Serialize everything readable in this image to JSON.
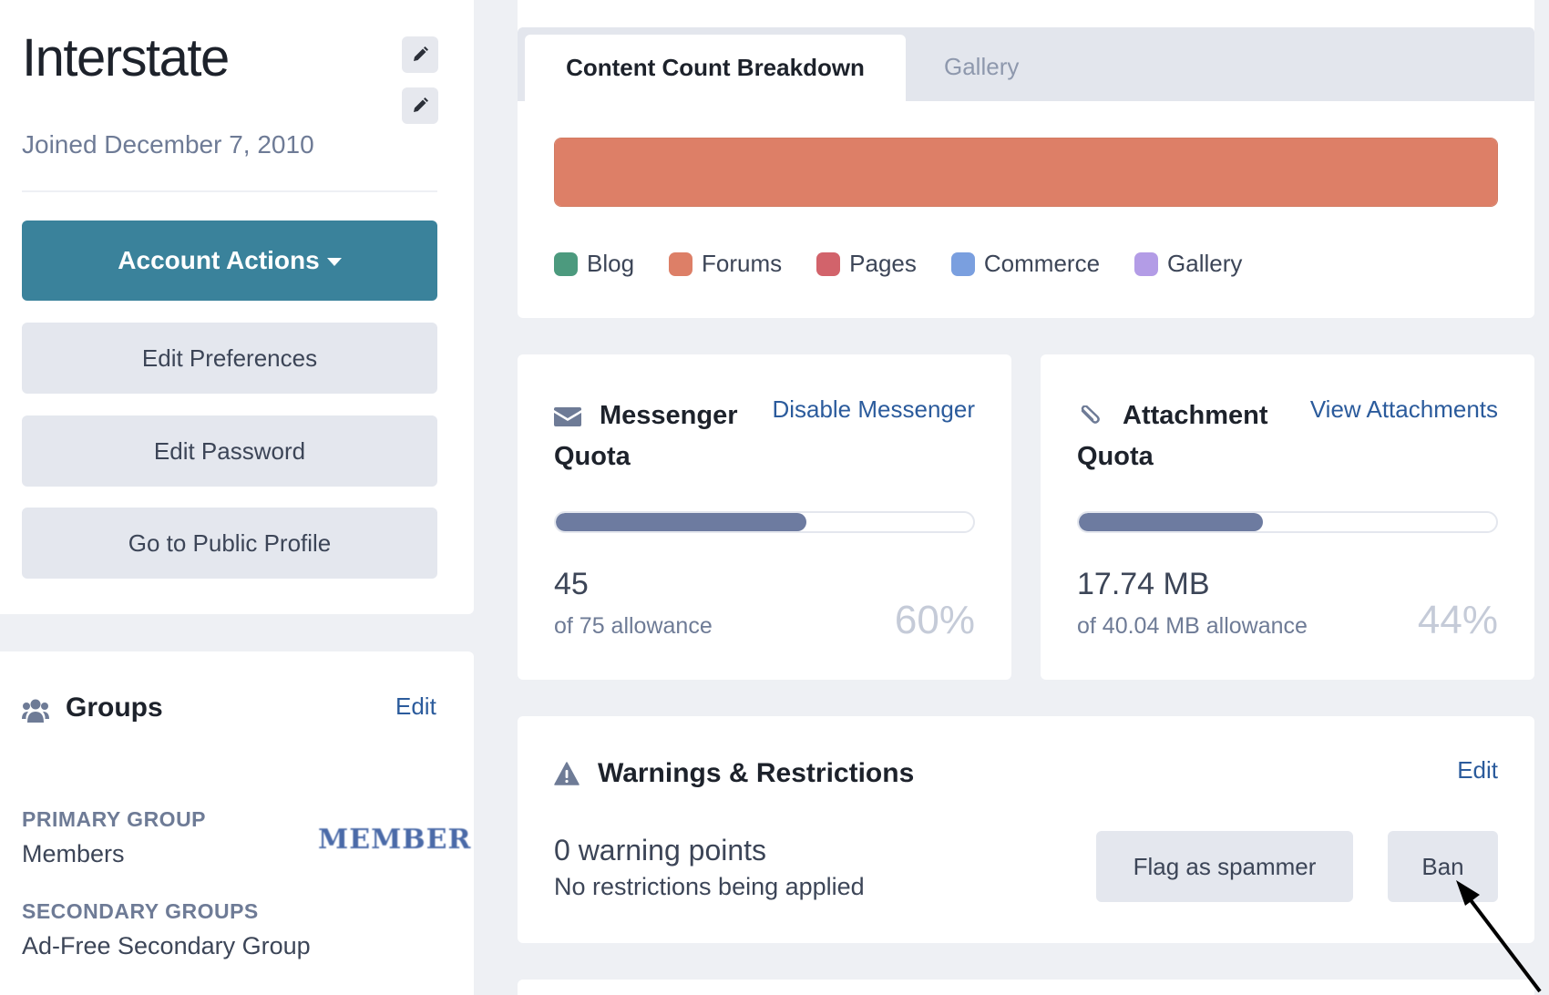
{
  "profile": {
    "name": "Interstate",
    "joined": "Joined December 7, 2010"
  },
  "actions": {
    "account_actions": "Account Actions",
    "edit_preferences": "Edit Preferences",
    "edit_password": "Edit Password",
    "public_profile": "Go to Public Profile"
  },
  "groups": {
    "title": "Groups",
    "edit": "Edit",
    "primary_label": "Primary Group",
    "primary_value": "Members",
    "primary_badge": "MEMBER",
    "secondary_label": "Secondary Groups",
    "secondary_value": "Ad-Free Secondary Group"
  },
  "content_count": {
    "tabs": [
      "Content Count Breakdown",
      "Gallery"
    ],
    "active_tab": 0,
    "legend": [
      {
        "name": "Blog",
        "color": "#4c9a7e"
      },
      {
        "name": "Forums",
        "color": "#dd7f67"
      },
      {
        "name": "Pages",
        "color": "#d2636b"
      },
      {
        "name": "Commerce",
        "color": "#7a9fdf"
      },
      {
        "name": "Gallery",
        "color": "#b39ce6"
      }
    ],
    "breakdown": [
      {
        "name": "Forums",
        "share": 1.0
      }
    ]
  },
  "messenger": {
    "title": "Messenger Quota",
    "link": "Disable Messenger",
    "value": "45",
    "sub": "of 75 allowance",
    "percent_label": "60%",
    "fraction": 0.6
  },
  "attachment": {
    "title": "Attachment Quota",
    "link": "View Attachments",
    "value": "17.74 MB",
    "sub": "of 40.04 MB allowance",
    "percent_label": "44%",
    "fraction": 0.44
  },
  "warnings": {
    "title": "Warnings & Restrictions",
    "edit": "Edit",
    "points": "0 warning points",
    "restrictions": "No restrictions being applied",
    "flag_button": "Flag as spammer",
    "ban_button": "Ban"
  },
  "colors": {
    "accent": "#3a829b",
    "link": "#2b5b9c",
    "quota_fill": "#6d7ba0"
  }
}
